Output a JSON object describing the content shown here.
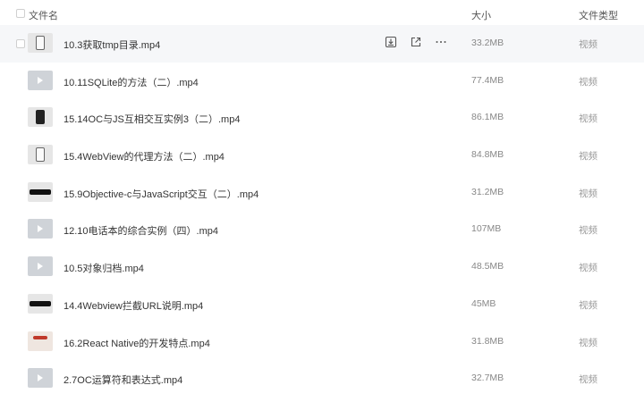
{
  "header": {
    "name_label": "文件名",
    "size_label": "大小",
    "type_label": "文件类型"
  },
  "files": [
    {
      "name": "10.3获取tmp目录.mp4",
      "size": "33.2MB",
      "type": "视频",
      "thumb": "phone",
      "hover": true
    },
    {
      "name": "10.11SQLite的方法（二）.mp4",
      "size": "77.4MB",
      "type": "视频",
      "thumb": "play"
    },
    {
      "name": "15.14OC与JS互相交互实例3（二）.mp4",
      "size": "86.1MB",
      "type": "视频",
      "thumb": "dark"
    },
    {
      "name": "15.4WebView的代理方法（二）.mp4",
      "size": "84.8MB",
      "type": "视频",
      "thumb": "phone"
    },
    {
      "name": "15.9Objective-c与JavaScript交互（二）.mp4",
      "size": "31.2MB",
      "type": "视频",
      "thumb": "bar"
    },
    {
      "name": "12.10电话本的综合实例（四）.mp4",
      "size": "107MB",
      "type": "视频",
      "thumb": "play"
    },
    {
      "name": "10.5对象归档.mp4",
      "size": "48.5MB",
      "type": "视频",
      "thumb": "play"
    },
    {
      "name": "14.4Webview拦截URL说明.mp4",
      "size": "45MB",
      "type": "视频",
      "thumb": "bar"
    },
    {
      "name": "16.2React Native的开发特点.mp4",
      "size": "31.8MB",
      "type": "视频",
      "thumb": "red"
    },
    {
      "name": "2.7OC运算符和表达式.mp4",
      "size": "32.7MB",
      "type": "视频",
      "thumb": "play"
    }
  ],
  "row_actions": [
    "download-icon",
    "share-icon",
    "more-icon"
  ]
}
